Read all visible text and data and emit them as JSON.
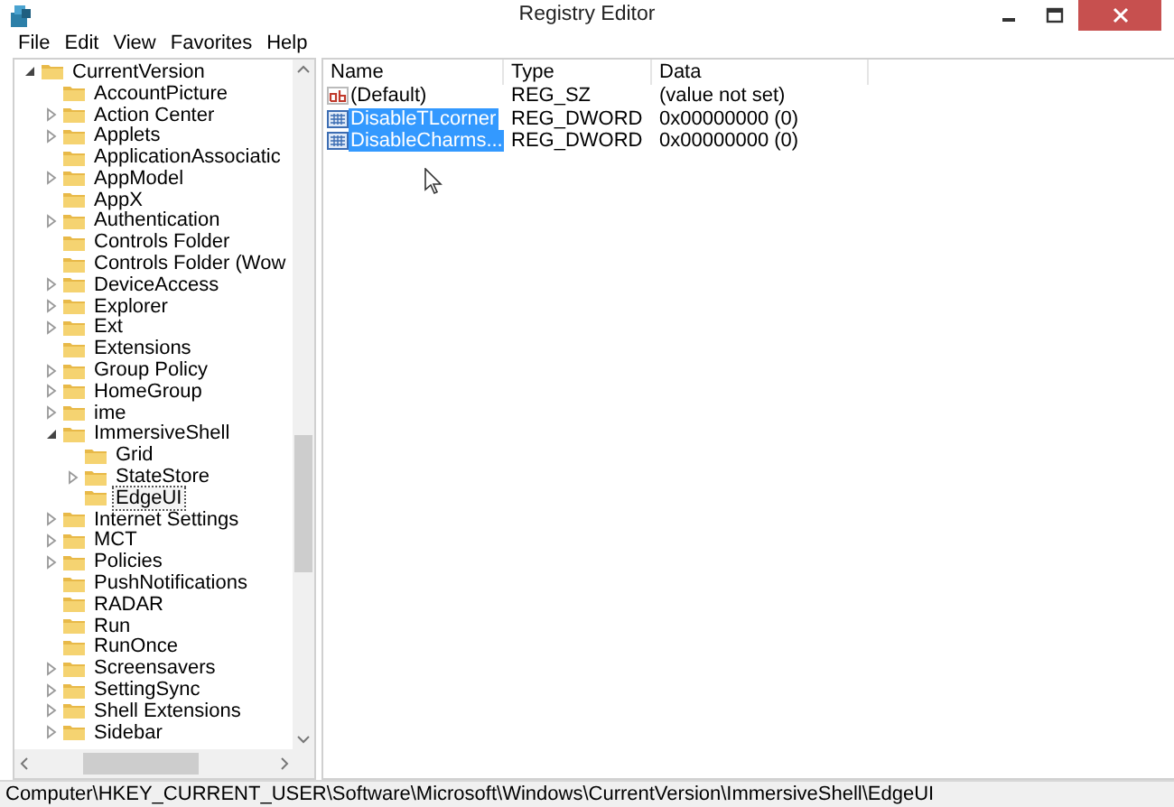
{
  "window": {
    "title": "Registry Editor"
  },
  "menu": [
    "File",
    "Edit",
    "View",
    "Favorites",
    "Help"
  ],
  "tree": [
    {
      "label": "CurrentVersion",
      "expandable": true,
      "expanded": true,
      "selected": false,
      "children": [
        {
          "label": "AccountPicture",
          "expandable": false,
          "selected": false
        },
        {
          "label": "Action Center",
          "expandable": true,
          "expanded": false,
          "selected": false
        },
        {
          "label": "Applets",
          "expandable": true,
          "expanded": false,
          "selected": false
        },
        {
          "label": "ApplicationAssociatic",
          "expandable": false,
          "selected": false
        },
        {
          "label": "AppModel",
          "expandable": true,
          "expanded": false,
          "selected": false
        },
        {
          "label": "AppX",
          "expandable": false,
          "selected": false
        },
        {
          "label": "Authentication",
          "expandable": true,
          "expanded": false,
          "selected": false
        },
        {
          "label": "Controls Folder",
          "expandable": false,
          "selected": false
        },
        {
          "label": "Controls Folder (Wow",
          "expandable": false,
          "selected": false
        },
        {
          "label": "DeviceAccess",
          "expandable": true,
          "expanded": false,
          "selected": false
        },
        {
          "label": "Explorer",
          "expandable": true,
          "expanded": false,
          "selected": false
        },
        {
          "label": "Ext",
          "expandable": true,
          "expanded": false,
          "selected": false
        },
        {
          "label": "Extensions",
          "expandable": false,
          "selected": false
        },
        {
          "label": "Group Policy",
          "expandable": true,
          "expanded": false,
          "selected": false
        },
        {
          "label": "HomeGroup",
          "expandable": true,
          "expanded": false,
          "selected": false
        },
        {
          "label": "ime",
          "expandable": true,
          "expanded": false,
          "selected": false
        },
        {
          "label": "ImmersiveShell",
          "expandable": true,
          "expanded": true,
          "selected": false,
          "children": [
            {
              "label": "Grid",
              "expandable": false,
              "selected": false
            },
            {
              "label": "StateStore",
              "expandable": true,
              "expanded": false,
              "selected": false
            },
            {
              "label": "EdgeUI",
              "expandable": false,
              "selected": true
            }
          ]
        },
        {
          "label": "Internet Settings",
          "expandable": true,
          "expanded": false,
          "selected": false
        },
        {
          "label": "MCT",
          "expandable": true,
          "expanded": false,
          "selected": false
        },
        {
          "label": "Policies",
          "expandable": true,
          "expanded": false,
          "selected": false
        },
        {
          "label": "PushNotifications",
          "expandable": false,
          "selected": false
        },
        {
          "label": "RADAR",
          "expandable": false,
          "selected": false
        },
        {
          "label": "Run",
          "expandable": false,
          "selected": false
        },
        {
          "label": "RunOnce",
          "expandable": false,
          "selected": false
        },
        {
          "label": "Screensavers",
          "expandable": true,
          "expanded": false,
          "selected": false
        },
        {
          "label": "SettingSync",
          "expandable": true,
          "expanded": false,
          "selected": false
        },
        {
          "label": "Shell Extensions",
          "expandable": true,
          "expanded": false,
          "selected": false
        },
        {
          "label": "Sidebar",
          "expandable": true,
          "expanded": false,
          "selected": false
        }
      ]
    }
  ],
  "values": {
    "columns": [
      "Name",
      "Type",
      "Data"
    ],
    "rows": [
      {
        "kind": "string",
        "name": "(Default)",
        "type": "REG_SZ",
        "data": "(value not set)",
        "selected": false
      },
      {
        "kind": "dword",
        "name": "DisableTLcorner",
        "type": "REG_DWORD",
        "data": "0x00000000 (0)",
        "selected": true
      },
      {
        "kind": "dword",
        "name": "DisableCharms...",
        "type": "REG_DWORD",
        "data": "0x00000000 (0)",
        "selected": true
      }
    ]
  },
  "status_bar": "Computer\\HKEY_CURRENT_USER\\Software\\Microsoft\\Windows\\CurrentVersion\\ImmersiveShell\\EdgeUI"
}
